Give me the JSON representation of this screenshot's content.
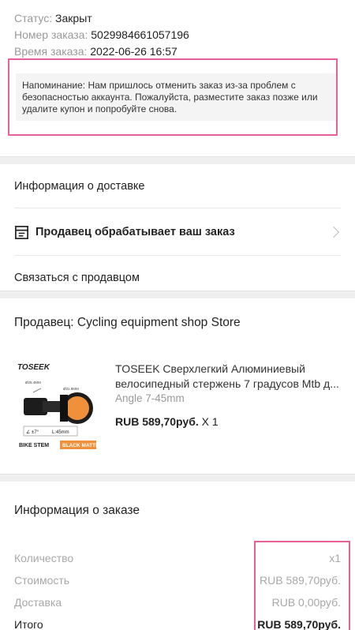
{
  "status": {
    "status_label": "Статус:",
    "status_value": "Закрыт",
    "order_no_label": "Номер заказа:",
    "order_no_value": "5029984661057196",
    "order_time_label": "Время заказа:",
    "order_time_value": "2022-06-26 16:57",
    "reminder": "Напоминание: Нам пришлось отменить заказ из-за проблем с безопасностью аккаунта. Пожалуйста, разместите заказ позже или удалите купон и попробуйте снова."
  },
  "delivery": {
    "info_label": "Информация о доставке",
    "processing_label": "Продавец обрабатывает ваш заказ",
    "contact_label": "Связаться с продавцом"
  },
  "seller": {
    "title": "Продавец: Cycling equipment shop Store",
    "product": {
      "name": "TOSEEK Сверхлегкий Алюминиевый велосипедный стержень 7 градусов Mtb д...",
      "variant": "Angle 7-45mm",
      "price": "RUB 589,70руб.",
      "qty": "X 1",
      "image_brand": "TOSEEK",
      "image_label_left": "BIKE STEM",
      "image_label_right": "BLACK MATTE",
      "image_angle": "∠ ±7°",
      "image_length": "L:45mm",
      "image_d1": "Ø25.4MM",
      "image_d2": "Ø31.8MM"
    }
  },
  "order_info": {
    "title": "Информация о заказе",
    "rows": [
      {
        "label": "Количество",
        "value": "x1"
      },
      {
        "label": "Стоимость",
        "value": "RUB 589,70руб."
      },
      {
        "label": "Доставка",
        "value": "RUB 0,00руб."
      },
      {
        "label": "Итого",
        "value": "RUB 589,70руб."
      }
    ]
  },
  "colors": {
    "highlight": "#e8609a",
    "accent_orange": "#f0903a"
  }
}
